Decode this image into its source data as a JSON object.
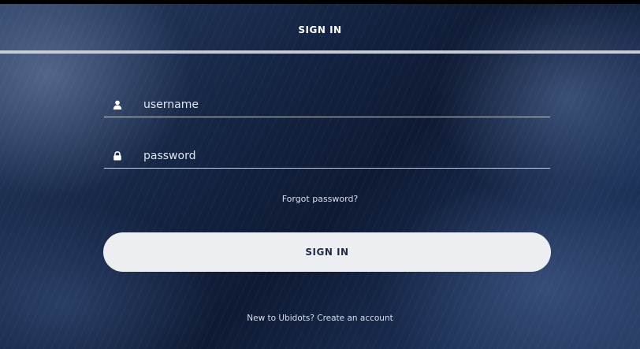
{
  "header": {
    "title": "SIGN IN"
  },
  "form": {
    "username": {
      "icon": "user-icon",
      "placeholder": "username",
      "value": ""
    },
    "password": {
      "icon": "lock-icon",
      "placeholder": "password",
      "value": ""
    },
    "forgot_label": "Forgot password?",
    "submit_label": "SIGN IN"
  },
  "footer": {
    "prompt": "New to Ubidots?",
    "link_label": "Create an account"
  },
  "colors": {
    "background": "#0f1c36",
    "button": "#eceef2",
    "button_text": "#1d2c49",
    "divider": "#c8ccd4"
  }
}
